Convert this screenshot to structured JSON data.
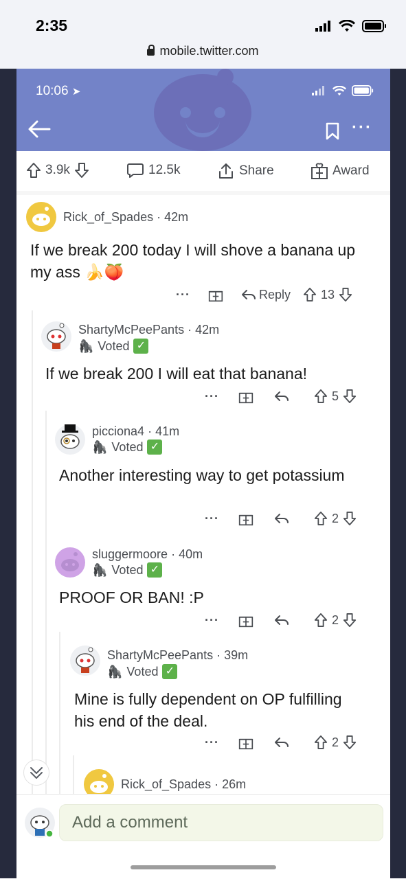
{
  "outer_status": {
    "time": "2:35"
  },
  "browser": {
    "url": "mobile.twitter.com"
  },
  "inner_status": {
    "time": "10:06"
  },
  "post_actions": {
    "upvotes": "3.9k",
    "comments": "12.5k",
    "share": "Share",
    "award": "Award"
  },
  "comments": [
    {
      "username": "Rick_of_Spades",
      "time": "42m",
      "text": "If we break 200 today I will shove a banana up my ass 🍌🍑",
      "reply_label": "Reply",
      "score": "13",
      "voted": null
    },
    {
      "username": "ShartyMcPeePants",
      "time": "42m",
      "text": "If we break 200 I will eat that banana!",
      "score": "5",
      "voted": "Voted"
    },
    {
      "username": "picciona4",
      "time": "41m",
      "text": "Another interesting way to get potassium",
      "score": "2",
      "voted": "Voted"
    },
    {
      "username": "sluggermoore",
      "time": "40m",
      "text": "PROOF OR BAN! :P",
      "score": "2",
      "voted": "Voted"
    },
    {
      "username": "ShartyMcPeePants",
      "time": "39m",
      "text": "Mine is fully dependent on OP fulfilling his end of the deal.",
      "score": "2",
      "voted": "Voted"
    },
    {
      "username": "Rick_of_Spades",
      "time": "26m"
    }
  ],
  "add_comment": {
    "placeholder": "Add a comment"
  },
  "colors": {
    "header": "#7383c8",
    "text": "#1c1c1c",
    "meta": "#4a4d52",
    "voted_check": "#5db14a",
    "input_bg": "#f3f7e8"
  }
}
